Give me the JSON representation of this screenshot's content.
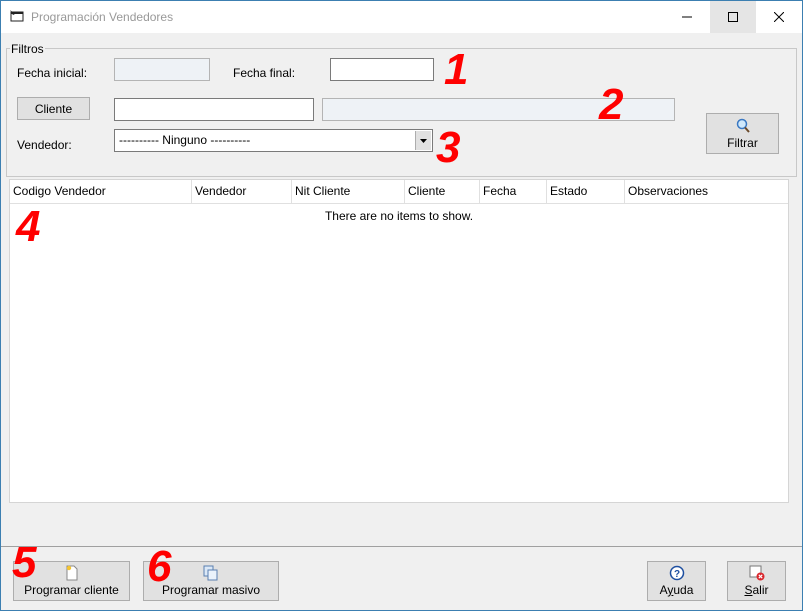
{
  "window": {
    "title": "Programación Vendedores"
  },
  "filters": {
    "legend": "Filtros",
    "fecha_inicial_label": "Fecha inicial:",
    "fecha_inicial_value": "",
    "fecha_final_label": "Fecha final:",
    "fecha_final_value": "",
    "cliente_button": "Cliente",
    "cliente_code_value": "",
    "cliente_name_value": "",
    "vendedor_label": "Vendedor:",
    "vendedor_selected": "---------- Ninguno ----------",
    "filtrar_button": "Filtrar"
  },
  "table": {
    "columns": [
      "Codigo Vendedor",
      "Vendedor",
      "Nit Cliente",
      "Cliente",
      "Fecha",
      "Estado",
      "Observaciones"
    ],
    "empty_message": "There are no items to show."
  },
  "footer": {
    "programar_cliente": "Programar cliente",
    "programar_masivo": "Programar masivo",
    "ayuda_pre": "A",
    "ayuda_u": "y",
    "ayuda_post": "uda",
    "salir_u": "S",
    "salir_post": "alir"
  },
  "annotations": [
    "1",
    "2",
    "3",
    "4",
    "5",
    "6"
  ],
  "colors": {
    "annotation": "#ff0000",
    "window_border": "#3c7fb1",
    "background": "#f0f0f0"
  }
}
